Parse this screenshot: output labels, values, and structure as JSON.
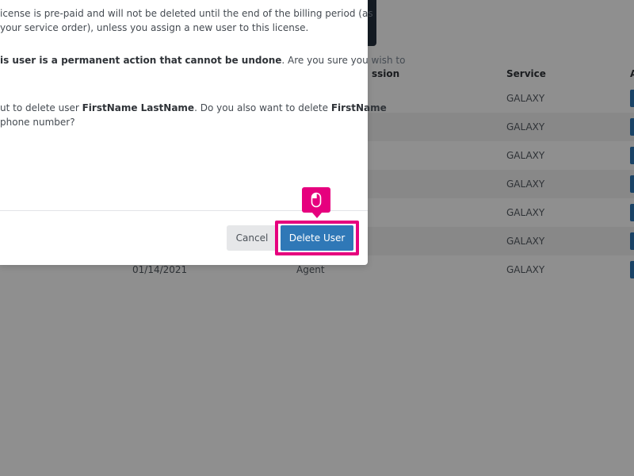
{
  "table": {
    "headers": {
      "session": "ssion",
      "service": "Service",
      "action": "A"
    },
    "rows": [
      {
        "date": "",
        "session": "",
        "service": "GALAXY"
      },
      {
        "date": "",
        "session": "",
        "service": "GALAXY"
      },
      {
        "date": "",
        "session": "",
        "service": "GALAXY"
      },
      {
        "date": "",
        "session": "",
        "service": "GALAXY"
      },
      {
        "date": "",
        "session": "",
        "service": "GALAXY"
      },
      {
        "date": "",
        "session": "",
        "service": "GALAXY"
      },
      {
        "date": "01/14/2021",
        "session": "Agent",
        "service": "GALAXY"
      }
    ]
  },
  "modal": {
    "p1_line1": "icense is pre-paid and will not be deleted until the end of the billing period (as",
    "p1_line2": "your service order), unless you assign a new user to this license.",
    "p2_bold_1": "is user is a permanent action that",
    "p2_bold_2": "cannot be undone",
    "p2_rest": ". Are you sure you wish to",
    "p3_pre": "ut to delete user ",
    "p3_name": "FirstName LastName",
    "p3_mid": ". Do you also want to delete ",
    "p3_name2": "FirstName",
    "p3_line2": "phone number?",
    "cancel_label": "Cancel",
    "delete_label": "Delete User"
  },
  "colors": {
    "primary": "#2f78b7",
    "highlight": "#e6007e",
    "overlay": "rgba(0,0,0,0.44)"
  },
  "cursor_icon": "mouse-click-icon"
}
